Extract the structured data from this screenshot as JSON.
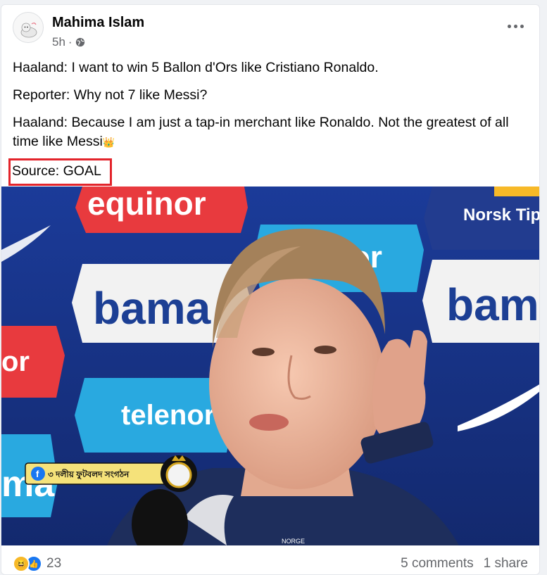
{
  "post": {
    "author": "Mahima Islam",
    "time": "5h",
    "separator": "·",
    "privacy_icon": "globe-icon",
    "lines": [
      "Haaland: I want to win 5 Ballon d'Ors like Cristiano Ronaldo.",
      "Reporter: Why not 7 like Messi?",
      "Haaland: Because I am just a tap-in merchant like Ronaldo. Not the greatest of all time like Messi"
    ],
    "crown_emoji": "👑",
    "source": "Source: GOAL"
  },
  "image": {
    "sponsor_logos": [
      "equinor",
      "bama",
      "telenor",
      "Norsk Tipp",
      "bam",
      "nor",
      "ma",
      "or"
    ],
    "watermark_text": "৩ দলীয় ফুটবলদ সংগঠন",
    "shirt_text": "NORGE"
  },
  "footer": {
    "reaction_icons": [
      "haha-icon",
      "like-icon"
    ],
    "reaction_count": "23",
    "comments": "5 comments",
    "shares": "1 share"
  },
  "colors": {
    "highlight_box": "#e3242b",
    "facebook_blue": "#1877f2",
    "text_secondary": "#65676b"
  }
}
